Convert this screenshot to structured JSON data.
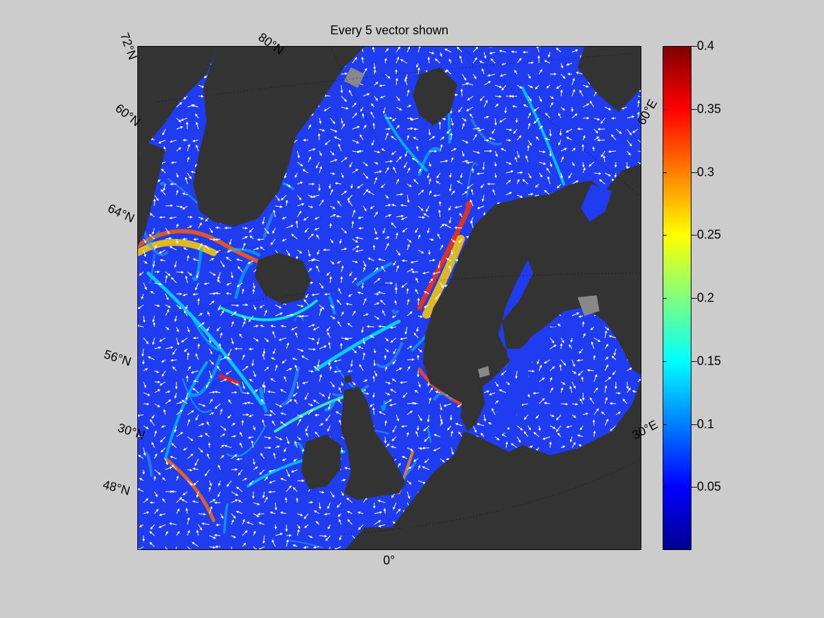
{
  "title": "Every 5 vector shown",
  "map": {
    "graticule_labels": {
      "lat_72": "72°N",
      "lat_80": "80°N",
      "lat_60_left": "60°N",
      "lat_64": "64°N",
      "lat_56": "56°N",
      "lat_30": "30°N",
      "lat_48": "48°N",
      "lon_0": "0°",
      "lon_60e": "60°E",
      "lon_30e": "30°E"
    },
    "colors": {
      "ocean_low": "#1f3cf0",
      "land": "#333333",
      "ice": "#888888",
      "vectors": "#ffffff"
    }
  },
  "colorbar": {
    "min": 0,
    "max": 0.4,
    "ticks": [
      "0.05",
      "0.1",
      "0.15",
      "0.2",
      "0.25",
      "0.3",
      "0.35",
      "0.4"
    ],
    "tick_values": [
      0.05,
      0.1,
      0.15,
      0.2,
      0.25,
      0.3,
      0.35,
      0.4
    ],
    "colormap": "jet"
  }
}
